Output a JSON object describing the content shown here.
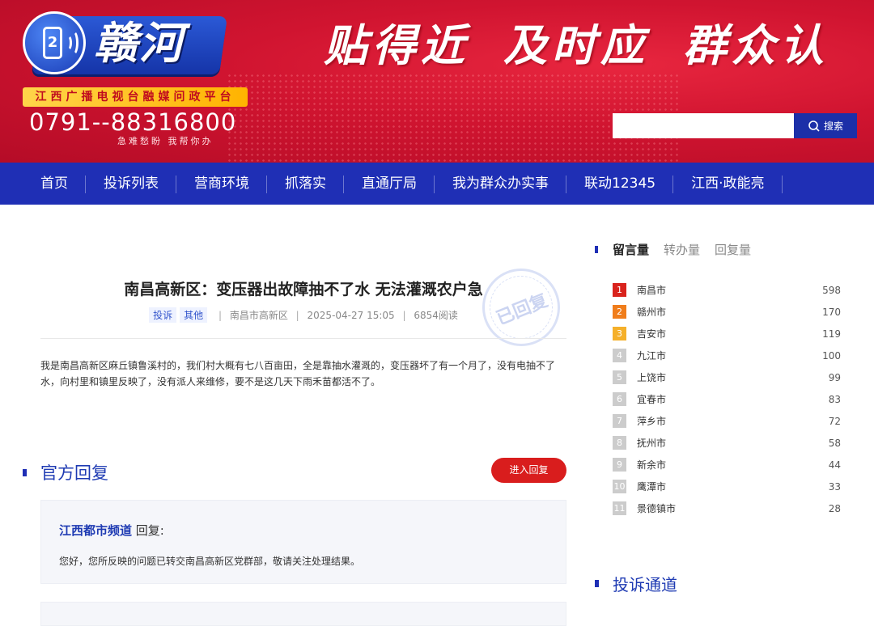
{
  "header": {
    "logo_text": "赣河",
    "logo_badge": "2",
    "platform": "江西广播电视台融媒问政平台",
    "hotline": "0791--88316800",
    "hotline_sub": "急难愁盼    我帮你办",
    "slogan": [
      "贴得近",
      "及时应",
      "群众认"
    ],
    "search": {
      "placeholder": "",
      "button_label": "搜索"
    }
  },
  "nav": {
    "items": [
      "首页",
      "投诉列表",
      "营商环境",
      "抓落实",
      "直通厅局",
      "我为群众办实事",
      "联动12345",
      "江西·政能亮"
    ]
  },
  "article": {
    "title": "南昌高新区：变压器出故障抽不了水 无法灌溉农户急",
    "tags": [
      "投诉",
      "其他"
    ],
    "location": "南昌市高新区",
    "datetime": "2025-04-27 15:05",
    "reads": "6854阅读",
    "stamp": "已回复",
    "body": "我是南昌高新区麻丘镇鲁溪村的，我们村大概有七八百亩田，全是靠抽水灌溉的，变压器坏了有一个月了，没有电抽不了水，向村里和镇里反映了，没有派人来维修，要不是这几天下雨禾苗都活不了。"
  },
  "reply": {
    "heading": "官方回复",
    "enter_button": "进入回复",
    "responder": "江西都市频道",
    "responder_suffix": " 回复:",
    "content": "您好，您所反映的问题已转交南昌高新区党群部，敬请关注处理结果。"
  },
  "sidebar": {
    "tabs": [
      "留言量",
      "转办量",
      "回复量"
    ],
    "active_tab": 0,
    "ranking": [
      {
        "rank": "1",
        "city": "南昌市",
        "count": "598",
        "color": "#d9231d"
      },
      {
        "rank": "2",
        "city": "赣州市",
        "count": "170",
        "color": "#f07d1b"
      },
      {
        "rank": "3",
        "city": "吉安市",
        "count": "119",
        "color": "#f5b02a"
      },
      {
        "rank": "4",
        "city": "九江市",
        "count": "100",
        "color": "#cccccc"
      },
      {
        "rank": "5",
        "city": "上饶市",
        "count": "99",
        "color": "#cccccc"
      },
      {
        "rank": "6",
        "city": "宜春市",
        "count": "83",
        "color": "#cccccc"
      },
      {
        "rank": "7",
        "city": "萍乡市",
        "count": "72",
        "color": "#cccccc"
      },
      {
        "rank": "8",
        "city": "抚州市",
        "count": "58",
        "color": "#cccccc"
      },
      {
        "rank": "9",
        "city": "新余市",
        "count": "44",
        "color": "#cccccc"
      },
      {
        "rank": "10",
        "city": "鹰潭市",
        "count": "33",
        "color": "#cccccc"
      },
      {
        "rank": "11",
        "city": "景德镇市",
        "count": "28",
        "color": "#cccccc"
      }
    ],
    "channel_heading": "投诉通道"
  }
}
